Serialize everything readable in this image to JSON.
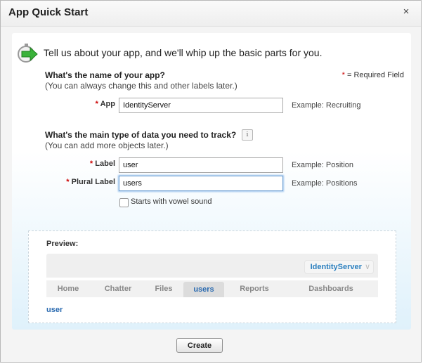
{
  "dialog": {
    "title": "App Quick Start",
    "close_symbol": "×"
  },
  "intro": {
    "icon": "stopwatch-arrow-icon",
    "text": "Tell us about your app, and we'll whip up the basic parts for you."
  },
  "required_note": {
    "star": "*",
    "text": " = Required Field"
  },
  "app_section": {
    "title": "What's the name of your app?",
    "subtitle": "(You can always change this and other labels later.)",
    "app_field": {
      "label": "App",
      "value": "IdentityServer",
      "example": "Example: Recruiting"
    }
  },
  "data_section": {
    "title": "What's the main type of data you need to track?",
    "info_symbol": "i",
    "subtitle": "(You can add more objects later.)",
    "label_field": {
      "label": "Label",
      "value": "user",
      "example": "Example: Position"
    },
    "plural_field": {
      "label": "Plural Label",
      "value": "users",
      "example": "Example: Positions"
    },
    "vowel_checkbox": {
      "label": "Starts with vowel sound",
      "checked": false
    }
  },
  "preview": {
    "title": "Preview:",
    "app_name": "IdentityServer",
    "tabs": [
      "Home",
      "Chatter",
      "Files",
      "users",
      "Reports",
      "Dashboards"
    ],
    "active_tab": "users",
    "link": "user"
  },
  "footer": {
    "create_label": "Create"
  },
  "colors": {
    "link_blue": "#2a6ab0",
    "required_red": "#cc0000",
    "panel_gradient_bottom": "#dff1fb"
  }
}
